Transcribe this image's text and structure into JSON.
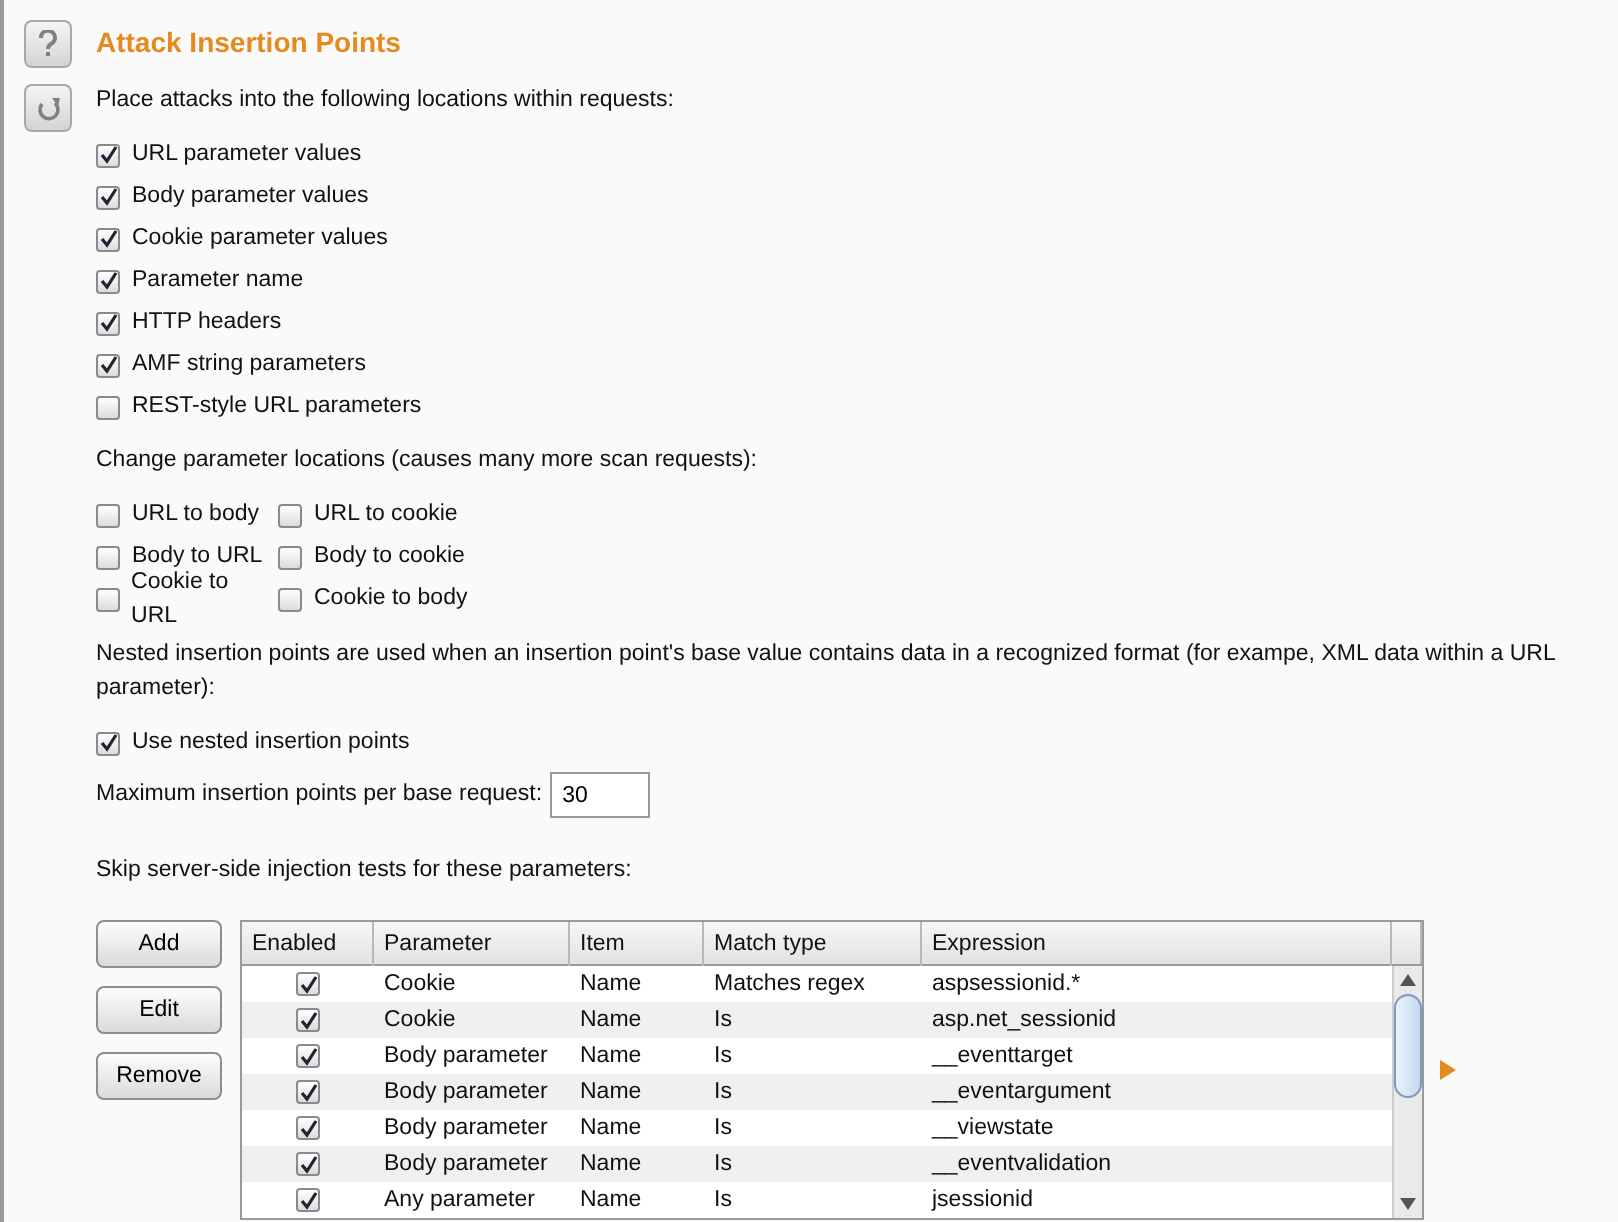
{
  "title": "Attack Insertion Points",
  "intro": "Place attacks into the following locations within requests:",
  "locations": [
    {
      "label": "URL parameter values",
      "checked": true
    },
    {
      "label": "Body parameter values",
      "checked": true
    },
    {
      "label": "Cookie parameter values",
      "checked": true
    },
    {
      "label": "Parameter name",
      "checked": true
    },
    {
      "label": "HTTP headers",
      "checked": true
    },
    {
      "label": "AMF string parameters",
      "checked": true
    },
    {
      "label": "REST-style URL parameters",
      "checked": false
    }
  ],
  "change_intro": "Change parameter locations (causes many more scan requests):",
  "changes": [
    {
      "label": "URL to body",
      "checked": false
    },
    {
      "label": "URL to cookie",
      "checked": false
    },
    {
      "label": "Body to URL",
      "checked": false
    },
    {
      "label": "Body to cookie",
      "checked": false
    },
    {
      "label": "Cookie to URL",
      "checked": false
    },
    {
      "label": "Cookie to body",
      "checked": false
    }
  ],
  "nested_intro": "Nested insertion points are used when an insertion point's base value contains data in a recognized format (for exampe, XML data within a URL parameter):",
  "nested": {
    "label": "Use nested insertion points",
    "checked": true
  },
  "max_points": {
    "label": "Maximum insertion points per base request:",
    "value": "30"
  },
  "skip_intro": "Skip server-side injection tests for these parameters:",
  "buttons": [
    "Add",
    "Edit",
    "Remove"
  ],
  "table": {
    "columns": [
      "Enabled",
      "Parameter",
      "Item",
      "Match type",
      "Expression"
    ],
    "rows": [
      {
        "enabled": true,
        "parameter": "Cookie",
        "item": "Name",
        "match_type": "Matches regex",
        "expression": "aspsessionid.*"
      },
      {
        "enabled": true,
        "parameter": "Cookie",
        "item": "Name",
        "match_type": "Is",
        "expression": "asp.net_sessionid"
      },
      {
        "enabled": true,
        "parameter": "Body parameter",
        "item": "Name",
        "match_type": "Is",
        "expression": "__eventtarget"
      },
      {
        "enabled": true,
        "parameter": "Body parameter",
        "item": "Name",
        "match_type": "Is",
        "expression": "__eventargument"
      },
      {
        "enabled": true,
        "parameter": "Body parameter",
        "item": "Name",
        "match_type": "Is",
        "expression": "__viewstate"
      },
      {
        "enabled": true,
        "parameter": "Body parameter",
        "item": "Name",
        "match_type": "Is",
        "expression": "__eventvalidation"
      },
      {
        "enabled": true,
        "parameter": "Any parameter",
        "item": "Name",
        "match_type": "Is",
        "expression": "jsessionid"
      }
    ]
  }
}
